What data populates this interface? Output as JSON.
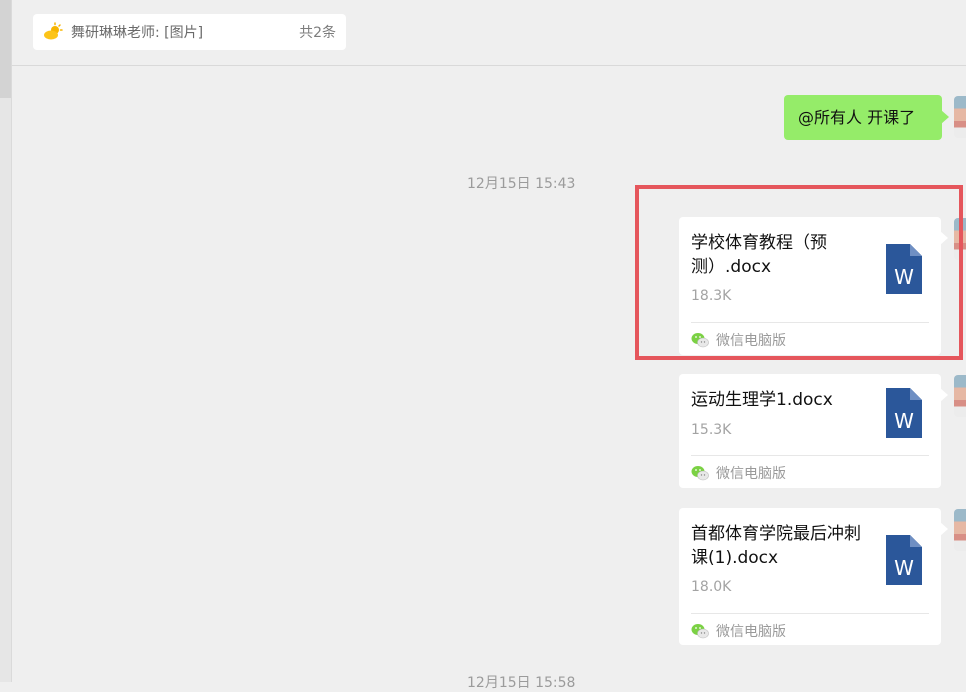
{
  "pinned": {
    "text": "舞研琳琳老师: [图片]",
    "count": "共2条",
    "icon": "sun-cloud-icon"
  },
  "messages": {
    "text_message": "@所有人 开课了",
    "timestamp": "12月15日 15:43",
    "files": [
      {
        "name": "学校体育教程（预测）.docx",
        "size": "18.3K",
        "source": "微信电脑版",
        "icon": "word-doc-icon"
      },
      {
        "name": "运动生理学1.docx",
        "size": "15.3K",
        "source": "微信电脑版",
        "icon": "word-doc-icon"
      },
      {
        "name": "首都体育学院最后冲刺课(1).docx",
        "size": "18.0K",
        "source": "微信电脑版",
        "icon": "word-doc-icon"
      }
    ],
    "bottom_timestamp": "12月15日 15:58"
  },
  "colors": {
    "my_bubble": "#95ec69",
    "highlight": "#e5565c",
    "word_blue": "#2b579a"
  }
}
